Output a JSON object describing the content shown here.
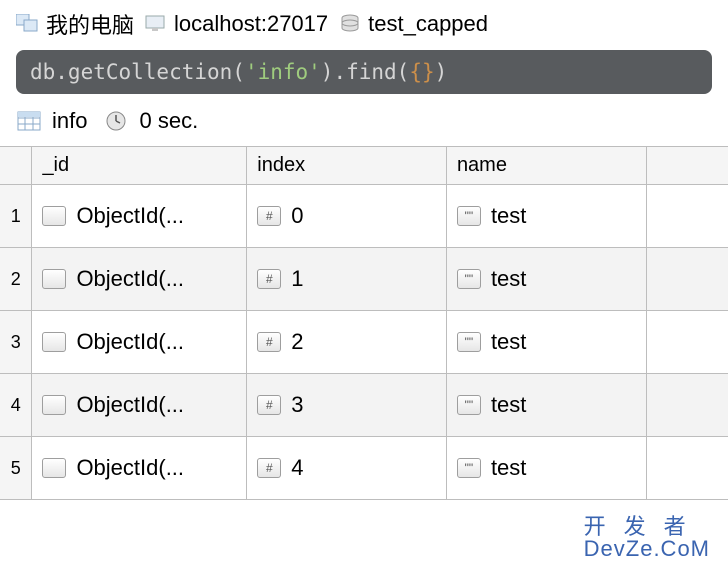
{
  "breadcrumb": {
    "computer": "我的电脑",
    "host": "localhost:27017",
    "collection": "test_capped"
  },
  "query": {
    "prefix": "db.getCollection(",
    "arg": "'info'",
    "mid": ").find(",
    "braces": "{}",
    "suffix": ")"
  },
  "status": {
    "tab": "info",
    "time": "0 sec."
  },
  "table": {
    "headers": {
      "id": "_id",
      "index": "index",
      "name": "name"
    },
    "badges": {
      "obj": "",
      "num": "#",
      "str": "\"\""
    },
    "rows": [
      {
        "n": "1",
        "id": "ObjectId(...",
        "index": "0",
        "name": "test"
      },
      {
        "n": "2",
        "id": "ObjectId(...",
        "index": "1",
        "name": "test"
      },
      {
        "n": "3",
        "id": "ObjectId(...",
        "index": "2",
        "name": "test"
      },
      {
        "n": "4",
        "id": "ObjectId(...",
        "index": "3",
        "name": "test"
      },
      {
        "n": "5",
        "id": "ObjectId(...",
        "index": "4",
        "name": "test"
      }
    ]
  },
  "watermark": {
    "line1": "开发者",
    "line2": "DevZe.CoM"
  }
}
